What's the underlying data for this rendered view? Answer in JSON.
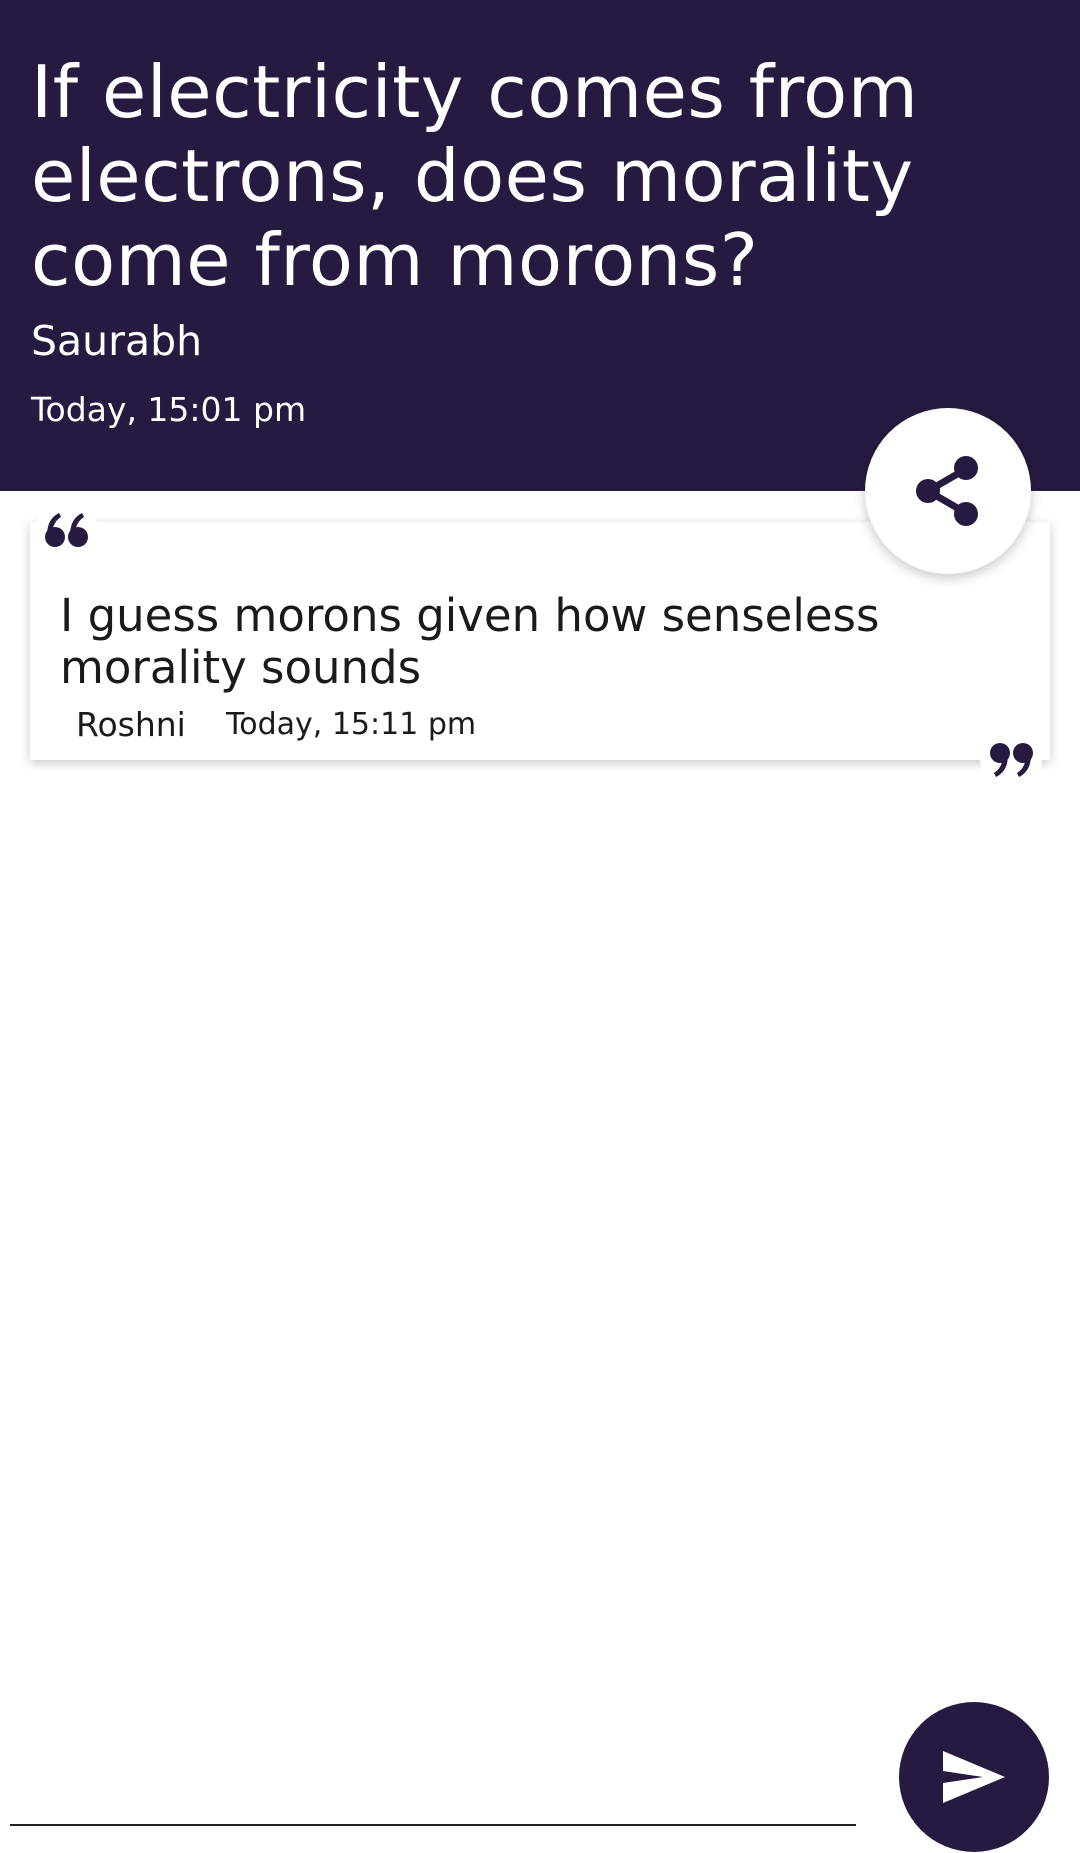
{
  "colors": {
    "header_bg": "#271a40",
    "accent": "#271a40",
    "text_dark": "#1a1a1a",
    "text_light": "#ffffff"
  },
  "question": {
    "text": "If electricity comes from electrons, does morality come from morons?",
    "author": "Saurabh",
    "timestamp": "Today, 15:01 pm"
  },
  "share_button": {
    "icon": "share-icon"
  },
  "answers": [
    {
      "text": "I guess morons given how senseless morality sounds",
      "author": "Roshni",
      "timestamp": "Today, 15:11 pm",
      "open_quote_icon": "quote-open-icon",
      "close_quote_icon": "quote-close-icon"
    }
  ],
  "reply": {
    "value": "",
    "placeholder": ""
  },
  "send_button": {
    "icon": "send-icon"
  }
}
